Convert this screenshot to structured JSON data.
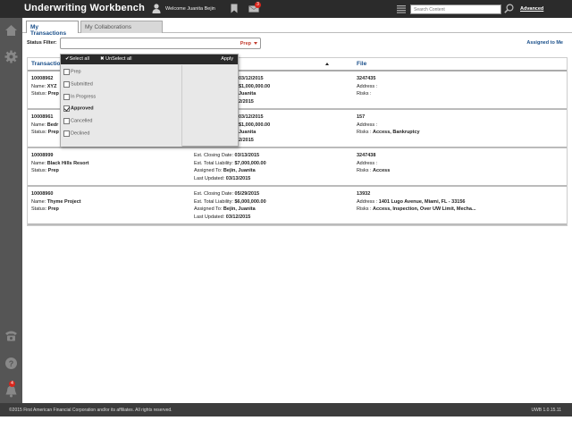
{
  "header": {
    "app_title": "Underwriting Workbench",
    "welcome": "Welcome Juanita Bejin",
    "mail_badge": "3",
    "search_placeholder": "Search Content",
    "advanced_label": "Advanced"
  },
  "sidebar": {
    "icons": [
      "home-icon",
      "gear-icon",
      "phone-icon",
      "help-icon",
      "bell-icon"
    ],
    "notification_badge": "4"
  },
  "tabs": {
    "transactions": "My Transactions",
    "collaborations": "My Collaborations"
  },
  "filter": {
    "label": "Status Filter:",
    "value": "Prep",
    "assigned_link": "Assigned to Me"
  },
  "dropdown": {
    "select_all": "✔Select all",
    "unselect_all": "✖ UnSelect all",
    "apply": "Apply",
    "options": [
      {
        "label": "Prep",
        "checked": false
      },
      {
        "label": "Submitted",
        "checked": false
      },
      {
        "label": "In Progress",
        "checked": false
      },
      {
        "label": "Approved",
        "checked": true
      },
      {
        "label": "Cancelled",
        "checked": false
      },
      {
        "label": "Declined",
        "checked": false
      }
    ]
  },
  "table": {
    "headers": {
      "transaction": "Transactio",
      "file": "File"
    },
    "rows": [
      {
        "id": "10008962",
        "name_label": "Name: ",
        "name": "XYZ",
        "status_label": "Status: ",
        "status": "Prep",
        "closing_label": "",
        "closing": "03/12/2015",
        "liability_label": "",
        "liability": "$1,000,000.00",
        "assigned_label": "",
        "assigned": "Juanita",
        "updated_label": "",
        "updated": "2/2015",
        "file": "3247435",
        "address_label": "Address : ",
        "address": "",
        "risks_label": "Risks : ",
        "risks": ""
      },
      {
        "id": "10008961",
        "name_label": "Name: ",
        "name": "Bedr",
        "status_label": "Status: ",
        "status": "Prep",
        "closing_label": "",
        "closing": "03/12/2015",
        "liability_label": "",
        "liability": "$1,000,000.00",
        "assigned_label": "",
        "assigned": "Juanita",
        "updated_label": "",
        "updated": "2/2015",
        "file": "157",
        "address_label": "Address : ",
        "address": "",
        "risks_label": "Risks : ",
        "risks": "Access, Bankruptcy"
      },
      {
        "id": "10008999",
        "name_label": "Name: ",
        "name": "Black Hills Resort",
        "status_label": "Status: ",
        "status": "Prep",
        "closing_label": "Est. Closing Date: ",
        "closing": "03/13/2015",
        "liability_label": "Est. Total Liability: ",
        "liability": "$7,000,000.00",
        "assigned_label": "Assigned To: ",
        "assigned": "Bejin, Juanita",
        "updated_label": "Last Updated: ",
        "updated": "03/13/2015",
        "file": "3247438",
        "address_label": "Address : ",
        "address": "",
        "risks_label": "Risks : ",
        "risks": "Access"
      },
      {
        "id": "10008960",
        "name_label": "Name: ",
        "name": "Thyme Project",
        "status_label": "Status: ",
        "status": "Prep",
        "closing_label": "Est. Closing Date: ",
        "closing": "05/29/2015",
        "liability_label": "Est. Total Liability: ",
        "liability": "$6,000,000.00",
        "assigned_label": "Assigned To: ",
        "assigned": "Bejin, Juanita",
        "updated_label": "Last Updated: ",
        "updated": "03/12/2015",
        "file": "13932",
        "address_label": "Address : ",
        "address": "1401 Lugo Avenue, Miami, FL - 33156",
        "risks_label": "Risks : ",
        "risks": "Access, Inspection, Over UW Limit, Mecha..."
      }
    ]
  },
  "footer": {
    "copyright": "©2015 First American Financial Corporation and/or its affiliates. All rights reserved.",
    "version": "UWB 1.0.15.11"
  },
  "colors": {
    "topbar": "#2b2b2b",
    "sidebar": "#555555",
    "link_blue": "#1a4f8a",
    "accent_red": "#c0392b",
    "badge_red": "#d9261c"
  }
}
